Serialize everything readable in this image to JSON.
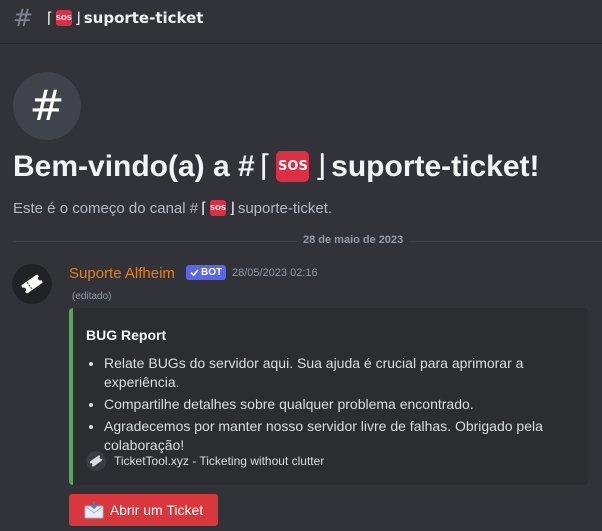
{
  "header": {
    "hash": "#",
    "bracket_open": "⌈",
    "emoji": "SOS",
    "bracket_close": "⌋",
    "channel_name": "suporte-ticket"
  },
  "welcome": {
    "icon": "#",
    "title_prefix": "Bem-vindo(a) a #",
    "bracket_open": "⌈",
    "emoji": "SOS",
    "bracket_close": "⌋",
    "title_suffix": "suporte-ticket!",
    "subtitle_prefix": "Este é o começo do canal #",
    "subtitle_suffix": "suporte-ticket."
  },
  "date_divider": "28 de maio de 2023",
  "message": {
    "author": "Suporte Alfheim",
    "bot_badge": "BOT",
    "timestamp": "28/05/2023 02:16",
    "edited": "(editado)",
    "embed": {
      "accent_color": "#57a75a",
      "title": "BUG Report",
      "items": [
        "Relate BUGs do servidor aqui. Sua ajuda é crucial para aprimorar a experiência.",
        "Compartilhe detalhes sobre qualquer problema encontrado.",
        "Agradecemos por manter nosso servidor livre de falhas. Obrigado pela colaboração!"
      ],
      "footer": "TicketTool.xyz - Ticketing without clutter"
    },
    "button": {
      "label": "Abrir um Ticket",
      "icon": "envelope-icon",
      "color": "#da373c"
    }
  }
}
